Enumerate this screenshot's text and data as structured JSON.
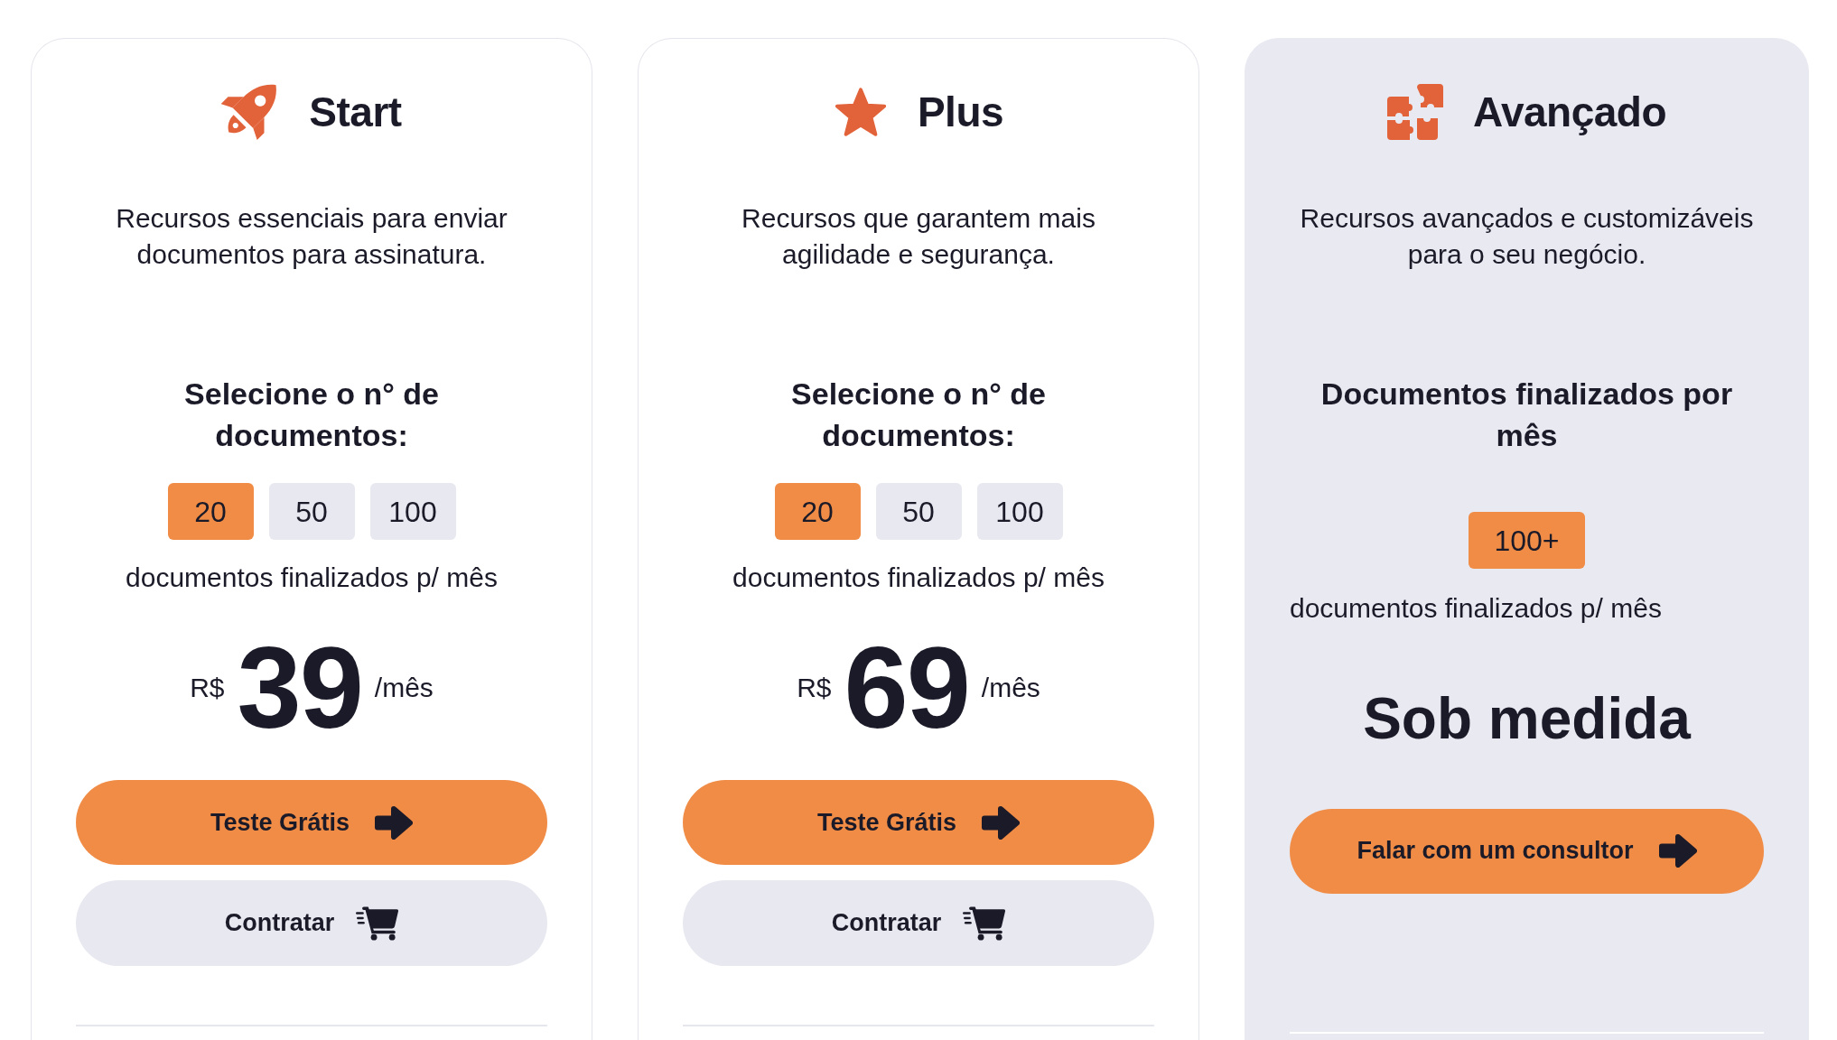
{
  "plans": [
    {
      "kind": "tiered",
      "name": "Start",
      "description": "Recursos essenciais para enviar documentos para assinatura.",
      "options_heading": "Selecione o n° de documentos:",
      "options": [
        {
          "label": "20",
          "selected": true
        },
        {
          "label": "50",
          "selected": false
        },
        {
          "label": "100",
          "selected": false
        }
      ],
      "options_caption": "documentos finalizados p/ mês",
      "price": {
        "currency": "R$",
        "amount": "39",
        "period": "/mês"
      },
      "buttons": [
        {
          "kind": "primary",
          "label": "Teste Grátis"
        },
        {
          "kind": "secondary",
          "label": "Contratar"
        }
      ]
    },
    {
      "kind": "tiered",
      "name": "Plus",
      "description": "Recursos que garantem mais agilidade e segurança.",
      "options_heading": "Selecione o n° de documentos:",
      "options": [
        {
          "label": "20",
          "selected": true
        },
        {
          "label": "50",
          "selected": false
        },
        {
          "label": "100",
          "selected": false
        }
      ],
      "options_caption": "documentos finalizados p/ mês",
      "price": {
        "currency": "R$",
        "amount": "69",
        "period": "/mês"
      },
      "buttons": [
        {
          "kind": "primary",
          "label": "Teste Grátis"
        },
        {
          "kind": "secondary",
          "label": "Contratar"
        }
      ]
    },
    {
      "kind": "custom",
      "name": "Avançado",
      "description": "Recursos avançados e customizáveis para o seu negócio.",
      "options_heading": "Documentos finalizados por mês",
      "options": [
        {
          "label": "100+",
          "selected": true
        }
      ],
      "options_caption": "documentos finalizados p/ mês",
      "price_text": "Sob medida",
      "buttons": [
        {
          "kind": "primary",
          "label": "Falar com um consultor"
        }
      ]
    }
  ]
}
